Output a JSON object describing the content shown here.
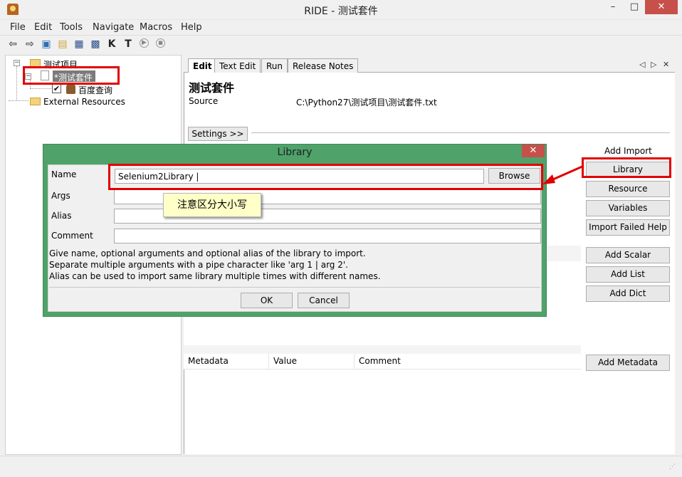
{
  "window": {
    "title": "RIDE - 测试套件",
    "app_icon": "ride-robot-icon",
    "controls": {
      "minimize": "–",
      "maximize": "□",
      "close": "✕"
    }
  },
  "menu": {
    "items": [
      "File",
      "Edit",
      "Tools",
      "Navigate",
      "Macros",
      "Help"
    ]
  },
  "toolbar": {
    "icons": [
      "back-arrow-icon",
      "forward-arrow-icon",
      "open-folder-icon",
      "open-directory-icon",
      "save-icon",
      "save-all-icon",
      "search-keywords-icon",
      "search-tests-icon",
      "run-icon",
      "stop-icon"
    ],
    "glyphs": {
      "back": "⇦",
      "forward": "⇨",
      "open": "▣",
      "opendir": "▤",
      "save": "▦",
      "saveall": "▩",
      "k": "K",
      "t": "T",
      "run": "▶",
      "stop": "■"
    }
  },
  "tree": {
    "project": "测试项目",
    "suite": "*测试套件",
    "testcase": "百度查询",
    "external": "External Resources",
    "check_glyph": "✔",
    "collapse_glyph": "−"
  },
  "editor": {
    "tabs": [
      {
        "label": "Edit",
        "active": true
      },
      {
        "label": "Text Edit",
        "active": false
      },
      {
        "label": "Run",
        "active": false
      },
      {
        "label": "Release Notes",
        "active": false
      }
    ],
    "tab_nav": {
      "left": "◁",
      "right": "▷",
      "close": "✕"
    },
    "suite_title": "测试套件",
    "source_label": "Source",
    "source_value": "C:\\Python27\\测试项目\\测试套件.txt",
    "settings_button": "Settings >>",
    "add_import_label": "Add Import",
    "side_buttons": [
      "Library",
      "Resource",
      "Variables",
      "Import Failed Help",
      "Add Scalar",
      "Add List",
      "Add Dict",
      "Add Metadata"
    ],
    "metadata_columns": [
      "Metadata",
      "Value",
      "Comment"
    ]
  },
  "dialog": {
    "title": "Library",
    "close": "✕",
    "fields": [
      {
        "label": "Name",
        "value": "Selenium2Library |"
      },
      {
        "label": "Args",
        "value": ""
      },
      {
        "label": "Alias",
        "value": ""
      },
      {
        "label": "Comment",
        "value": ""
      }
    ],
    "browse": "Browse",
    "help": [
      "Give name, optional arguments and optional alias of the library to import.",
      "Separate multiple arguments with a pipe character like 'arg 1 | arg 2'.",
      "Alias can be used to import same library multiple times with different names."
    ],
    "ok": "OK",
    "cancel": "Cancel"
  },
  "annotation": {
    "note": "注意区分大小写",
    "highlight_color": "#e10000",
    "note_bg": "#ffffc8"
  },
  "statusbar": {
    "grip": "⋰"
  }
}
